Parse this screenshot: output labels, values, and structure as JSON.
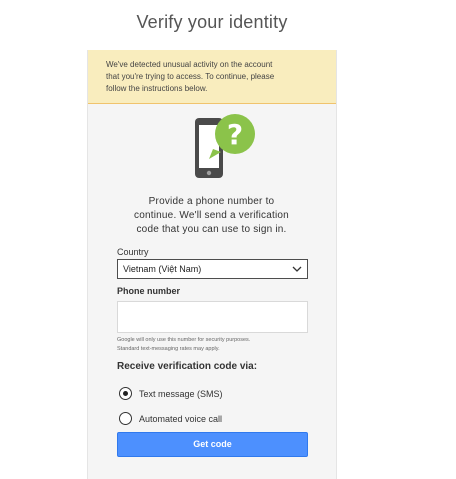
{
  "page": {
    "title": "Verify your identity"
  },
  "warning": {
    "text_line1": "We've detected unusual activity on the account",
    "text_line2": "that you're trying to access. To continue, please",
    "text_line3": "follow the instructions below."
  },
  "instructions": {
    "line1": "Provide a phone number to",
    "line2": "continue. We'll send a verification",
    "line3": "code that you can use to sign in."
  },
  "country": {
    "label": "Country",
    "selected": "Vietnam (Việt Nam)"
  },
  "phone": {
    "label": "Phone number",
    "value": "",
    "fine_print_line1": "Google will only use this number for security purposes.",
    "fine_print_line2": "Standard text-messaging rates may apply."
  },
  "method": {
    "label": "Receive verification code via:",
    "options": [
      {
        "label": "Text message (SMS)",
        "selected": true
      },
      {
        "label": "Automated voice call",
        "selected": false
      }
    ]
  },
  "actions": {
    "get_code_label": "Get code"
  },
  "colors": {
    "warning_bg": "#f9edbe",
    "button_blue": "#4d90fe",
    "icon_green": "#8bc34a",
    "phone_dark": "#4a4a4a"
  },
  "icons": {
    "illustration": "phone-question-icon",
    "dropdown": "chevron-down-icon"
  }
}
